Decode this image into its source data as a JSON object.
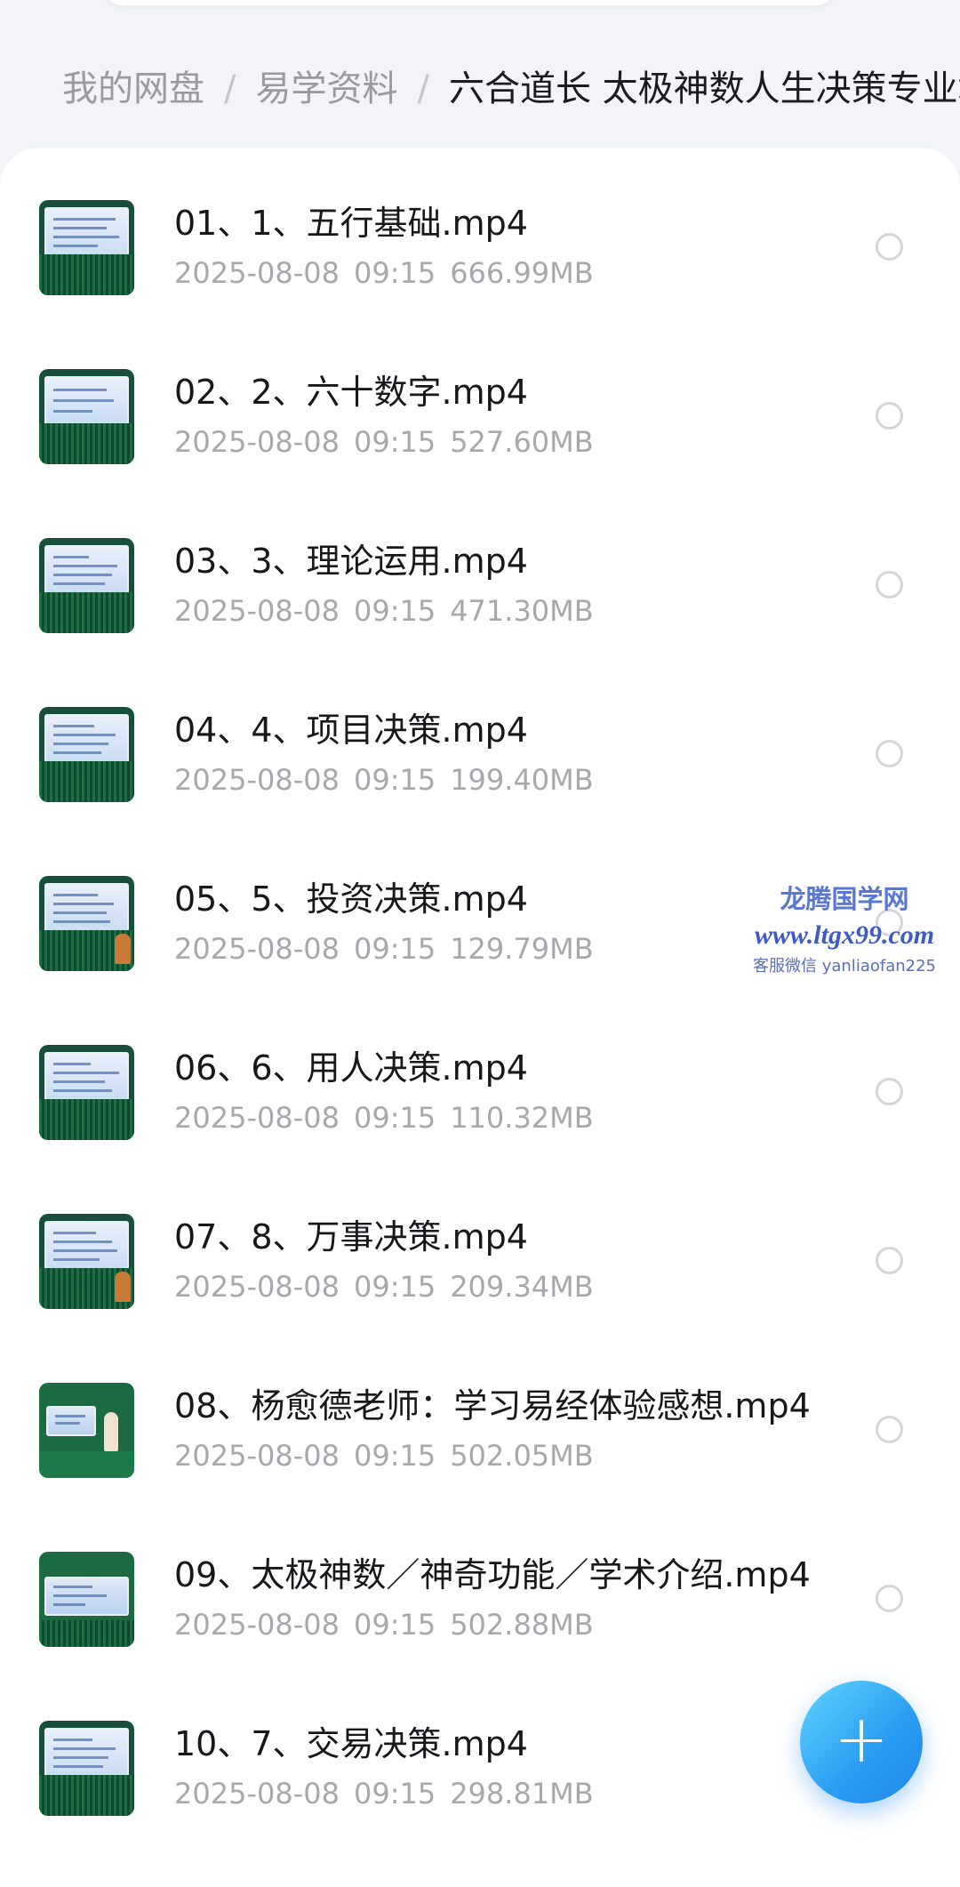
{
  "breadcrumb": {
    "items": [
      "我的网盘",
      "易学资料"
    ],
    "separator": "/",
    "current": "六合道长 太极神数人生决策专业培训"
  },
  "files": [
    {
      "name": "01、1、五行基础.mp4",
      "date": "2025-08-08",
      "time": "09:15",
      "size": "666.99MB",
      "thumb_icon": "video-thumbnail"
    },
    {
      "name": "02、2、六十数字.mp4",
      "date": "2025-08-08",
      "time": "09:15",
      "size": "527.60MB",
      "thumb_icon": "video-thumbnail"
    },
    {
      "name": "03、3、理论运用.mp4",
      "date": "2025-08-08",
      "time": "09:15",
      "size": "471.30MB",
      "thumb_icon": "video-thumbnail"
    },
    {
      "name": "04、4、项目决策.mp4",
      "date": "2025-08-08",
      "time": "09:15",
      "size": "199.40MB",
      "thumb_icon": "video-thumbnail"
    },
    {
      "name": "05、5、投资决策.mp4",
      "date": "2025-08-08",
      "time": "09:15",
      "size": "129.79MB",
      "thumb_icon": "video-thumbnail"
    },
    {
      "name": "06、6、用人决策.mp4",
      "date": "2025-08-08",
      "time": "09:15",
      "size": "110.32MB",
      "thumb_icon": "video-thumbnail"
    },
    {
      "name": "07、8、万事决策.mp4",
      "date": "2025-08-08",
      "time": "09:15",
      "size": "209.34MB",
      "thumb_icon": "video-thumbnail"
    },
    {
      "name": "08、杨愈德老师：学习易经体验感想.mp4",
      "date": "2025-08-08",
      "time": "09:15",
      "size": "502.05MB",
      "thumb_icon": "video-thumbnail"
    },
    {
      "name": "09、太极神数／神奇功能／学术介绍.mp4",
      "date": "2025-08-08",
      "time": "09:15",
      "size": "502.88MB",
      "thumb_icon": "video-thumbnail"
    },
    {
      "name": "10、7、交易决策.mp4",
      "date": "2025-08-08",
      "time": "09:15",
      "size": "298.81MB",
      "thumb_icon": "video-thumbnail"
    }
  ],
  "watermark": {
    "title": "龙腾国学网",
    "url": "www.ltgx99.com",
    "contact": "客服微信 yanliaofan225"
  },
  "fab": {
    "label": "+",
    "icon": "plus-icon"
  },
  "colors": {
    "accent": "#2a9cf2",
    "background": "#f3f4f8",
    "card": "#ffffff",
    "text_primary": "#17181b",
    "text_secondary": "#a6a8ad"
  }
}
